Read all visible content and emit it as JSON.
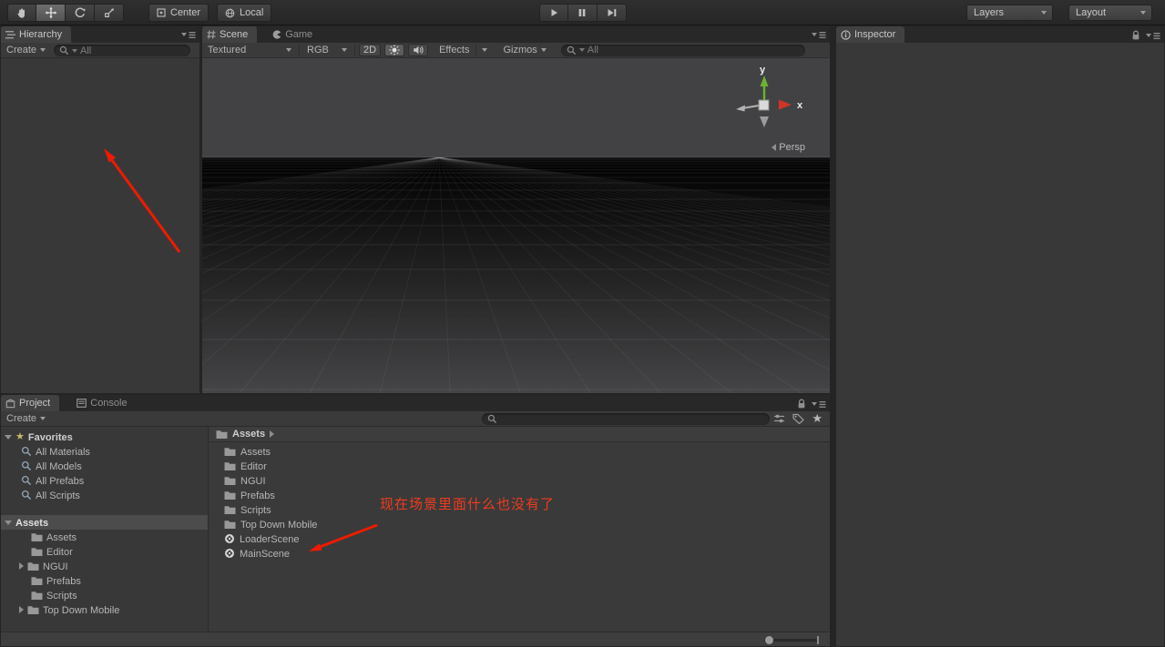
{
  "colors": {
    "annotation_red": "#f03b1e",
    "axis_green": "#6ab42f",
    "axis_red": "#cf3527",
    "panel_bg": "#383838"
  },
  "toolbar": {
    "tools": [
      "hand-tool",
      "move-tool",
      "rotate-tool",
      "scale-tool"
    ],
    "center_label": "Center",
    "local_label": "Local",
    "layers_label": "Layers",
    "layout_label": "Layout"
  },
  "hierarchy": {
    "tab_label": "Hierarchy",
    "create_label": "Create",
    "search_filter": "All"
  },
  "scene_view": {
    "tab_scene": "Scene",
    "tab_game": "Game",
    "shading": "Textured",
    "channel": "RGB",
    "mode_2d": "2D",
    "effects": "Effects",
    "gizmos": "Gizmos",
    "search_filter": "All",
    "projection": "Persp",
    "axis_x": "x",
    "axis_y": "y"
  },
  "inspector": {
    "tab_label": "Inspector"
  },
  "project": {
    "tab_project": "Project",
    "tab_console": "Console",
    "create_label": "Create",
    "favorites_label": "Favorites",
    "favorites": [
      "All Materials",
      "All Models",
      "All Prefabs",
      "All Scripts"
    ],
    "root_label": "Assets",
    "folders": [
      "Assets",
      "Editor",
      "NGUI",
      "Prefabs",
      "Scripts",
      "Top Down Mobile"
    ],
    "breadcrumb": "Assets",
    "items": [
      {
        "label": "Assets",
        "type": "folder"
      },
      {
        "label": "Editor",
        "type": "folder"
      },
      {
        "label": "NGUI",
        "type": "folder"
      },
      {
        "label": "Prefabs",
        "type": "folder"
      },
      {
        "label": "Scripts",
        "type": "folder"
      },
      {
        "label": "Top Down Mobile",
        "type": "folder"
      },
      {
        "label": "LoaderScene",
        "type": "scene"
      },
      {
        "label": "MainScene",
        "type": "scene"
      }
    ]
  },
  "annotation": {
    "text": "现在场景里面什么也没有了",
    "color": "#f03b1e"
  }
}
